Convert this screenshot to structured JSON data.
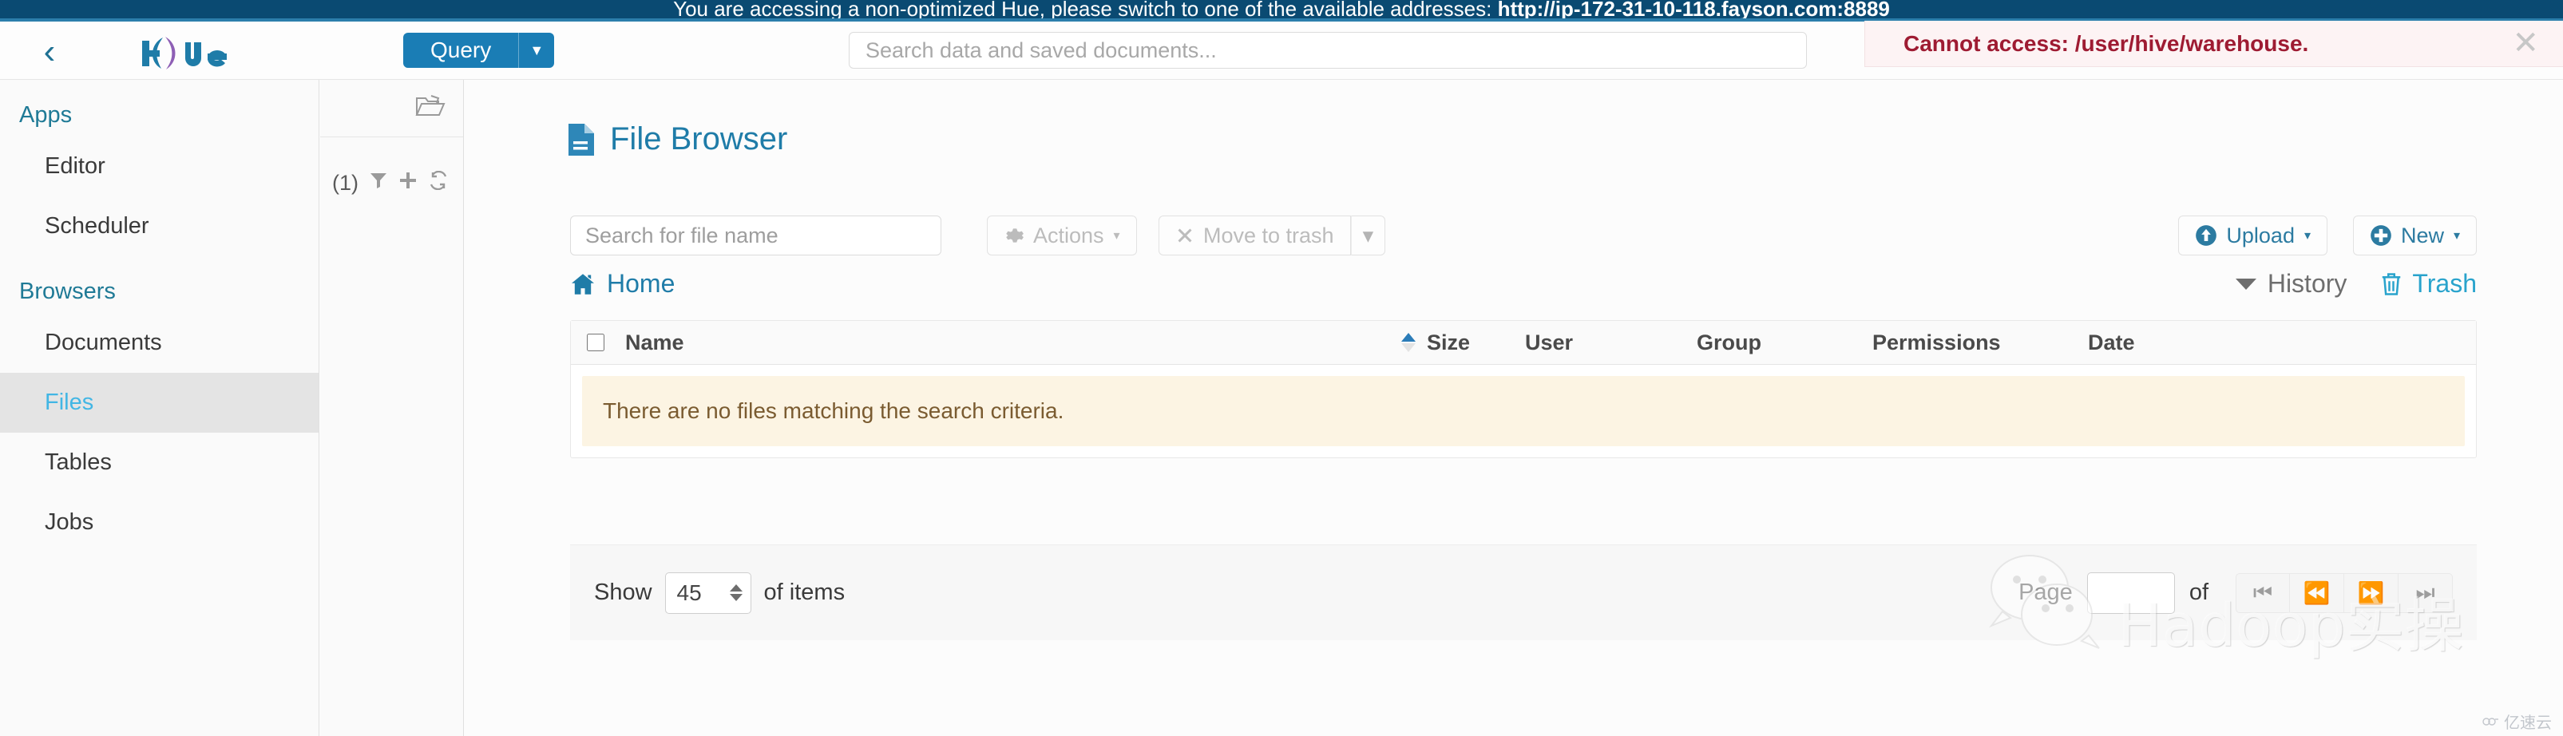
{
  "banner": {
    "text_prefix": "You are accessing a non-optimized Hue, please switch to one of the available addresses: ",
    "url": "http://ip-172-31-10-118.fayson.com:8889",
    "bg_color": "#0a4a72"
  },
  "alert": {
    "message": "Cannot access: /user/hive/warehouse.",
    "close_label": "✕",
    "text_color": "#9e1b32",
    "bg_color": "#fdf3f4"
  },
  "header": {
    "back_icon": "‹",
    "logo_text": "hue",
    "query_button": "Query",
    "query_caret": "▼",
    "search_placeholder": "Search data and saved documents...",
    "search_value": ""
  },
  "sidebar": {
    "groups": [
      {
        "title": "Apps",
        "items": [
          {
            "label": "Editor"
          },
          {
            "label": "Scheduler"
          }
        ]
      },
      {
        "title": "Browsers",
        "items": [
          {
            "label": "Documents"
          },
          {
            "label": "Files"
          },
          {
            "label": "Tables"
          },
          {
            "label": "Jobs"
          }
        ]
      }
    ],
    "active_item": "Files",
    "active_color": "#42b6e4",
    "group_title_color": "#1f7a96"
  },
  "assist": {
    "folder_icon": "folder-open-icon",
    "count_label": "(1)",
    "filter_icon": "filter-icon",
    "add_icon": "plus-icon",
    "refresh_icon": "refresh-icon"
  },
  "main": {
    "page_title": "File Browser",
    "toolbar": {
      "file_search_placeholder": "Search for file name",
      "file_search_value": "",
      "actions_label": "Actions",
      "actions_caret": "▾",
      "move_to_trash_label": "Move to trash",
      "move_to_trash_disabled": true,
      "trash_caret": "▾",
      "upload_label": "Upload",
      "upload_caret": "▾",
      "new_label": "New",
      "new_caret": "▾"
    },
    "breadcrumb": {
      "home_label": "Home"
    },
    "right_links": {
      "history_label": "History",
      "trash_label": "Trash"
    },
    "table": {
      "columns": [
        "Name",
        "Size",
        "User",
        "Group",
        "Permissions",
        "Date"
      ],
      "sort_column": "Size",
      "sort_direction": "asc",
      "rows": [],
      "empty_message": "There are no files matching the search criteria."
    },
    "pagination": {
      "show_label": "Show",
      "page_size": "45",
      "of_items_label": "of items",
      "page_label": "Page",
      "page_value": "",
      "of_label": "of",
      "first_icon": "⏮",
      "prev_icon": "⏪",
      "next_icon": "⏩",
      "last_icon": "⏭"
    }
  },
  "watermark": {
    "text": "Hadoop实操",
    "icon": "wechat-icon"
  },
  "corner": {
    "text": "亿速云"
  }
}
